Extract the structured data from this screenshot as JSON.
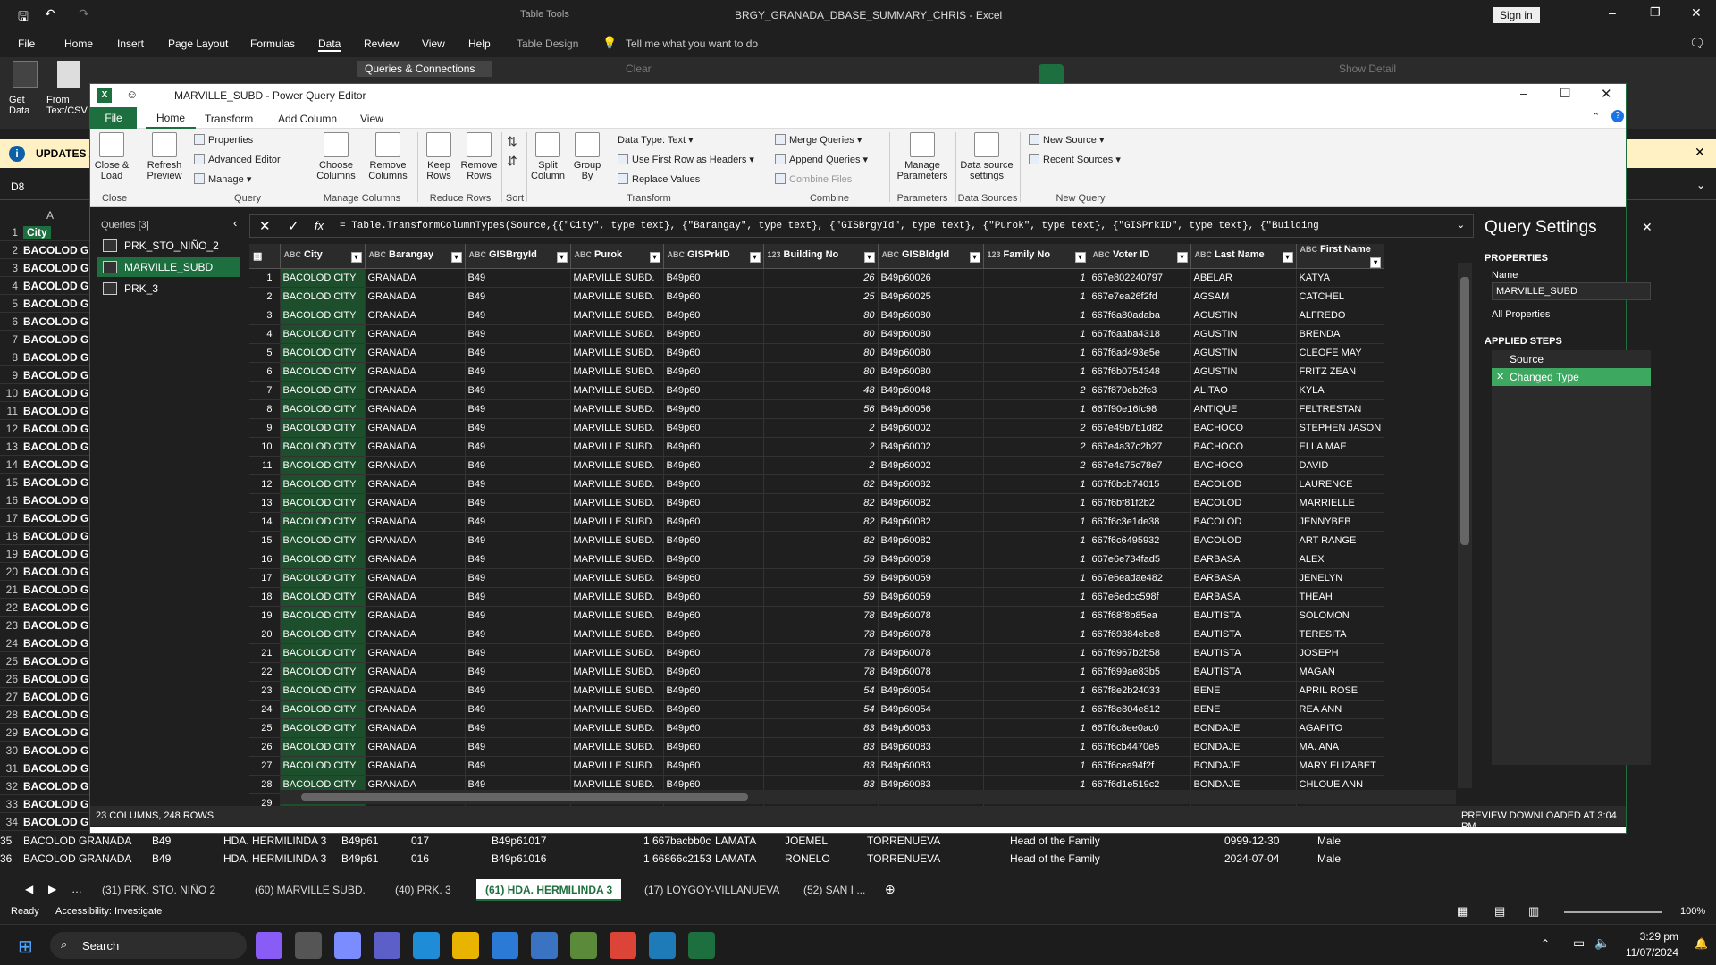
{
  "excel": {
    "title": "BRGY_GRANADA_DBASE_SUMMARY_CHRIS - Excel",
    "table_tools": "Table Tools",
    "sign_in": "Sign in",
    "menu": [
      "File",
      "Home",
      "Insert",
      "Page Layout",
      "Formulas",
      "Data",
      "Review",
      "View",
      "Help",
      "Table Design"
    ],
    "tell_me": "Tell me what you want to do",
    "ribbon": {
      "get_data": "Get Data",
      "from_text": "From Text/CSV",
      "queries_connections": "Queries & Connections",
      "clear": "Clear",
      "show_detail": "Show Detail"
    },
    "info_bar": "UPDATES A",
    "name_box": "D8",
    "col_a": "A",
    "col_b": "B",
    "header_city": "City",
    "left_rows": [
      "1",
      "2",
      "3",
      "4",
      "5",
      "6",
      "7",
      "8",
      "9",
      "10",
      "11",
      "12",
      "13",
      "14",
      "15",
      "16",
      "17",
      "18",
      "19",
      "20",
      "21",
      "22",
      "23",
      "24",
      "25",
      "26",
      "27",
      "28",
      "29",
      "30",
      "31",
      "32",
      "33",
      "34"
    ],
    "left_cell": "BACOLOD G",
    "bottom_rows": [
      {
        "rn": "35",
        "a": "BACOLOD GRANADA",
        "b": "B49",
        "c": "HDA. HERMILINDA 3",
        "d": "B49p61",
        "e": "017",
        "f": "B49p61017",
        "g": "1",
        "h": "667bacbb0c",
        "i": "LAMATA",
        "j": "JOEMEL",
        "k": "TORRENUEVA",
        "l": "Head of the Family",
        "m": "0999-12-30",
        "n": "Male"
      },
      {
        "rn": "36",
        "a": "BACOLOD GRANADA",
        "b": "B49",
        "c": "HDA. HERMILINDA 3",
        "d": "B49p61",
        "e": "016",
        "f": "B49p61016",
        "g": "1",
        "h": "66866c2153",
        "i": "LAMATA",
        "j": "RONELO",
        "k": "TORRENUEVA",
        "l": "Head of the Family",
        "m": "2024-07-04",
        "n": "Male"
      }
    ],
    "sheet_tabs": [
      "(31) PRK. STO. NIÑO 2",
      "(60) MARVILLE SUBD.",
      "(40) PRK. 3",
      "(61) HDA. HERMILINDA 3",
      "(17) LOYGOY-VILLANUEVA",
      "(52) SAN I ..."
    ],
    "active_sheet": 3,
    "status_ready": "Ready",
    "accessibility": "Accessibility: Investigate",
    "zoom": "100%"
  },
  "pq": {
    "title": "MARVILLE_SUBD - Power Query Editor",
    "tabs": [
      "File",
      "Home",
      "Transform",
      "Add Column",
      "View"
    ],
    "ribbon": {
      "close_load": "Close & Load",
      "refresh_preview": "Refresh Preview",
      "properties": "Properties",
      "advanced_editor": "Advanced Editor",
      "manage": "Manage",
      "choose_columns": "Choose Columns",
      "remove_columns": "Remove Columns",
      "keep_rows": "Keep Rows",
      "remove_rows": "Remove Rows",
      "split_column": "Split Column",
      "group_by": "Group By",
      "data_type": "Data Type: Text",
      "first_row_headers": "Use First Row as Headers",
      "replace_values": "Replace Values",
      "merge_queries": "Merge Queries",
      "append_queries": "Append Queries",
      "combine_files": "Combine Files",
      "manage_parameters": "Manage Parameters",
      "data_source_settings": "Data source settings",
      "new_source": "New Source",
      "recent_sources": "Recent Sources",
      "groups": [
        "Close",
        "Query",
        "Manage Columns",
        "Reduce Rows",
        "Sort",
        "Transform",
        "Combine",
        "Parameters",
        "Data Sources",
        "New Query"
      ]
    },
    "queries_header": "Queries [3]",
    "queries": [
      "PRK_STO_NIÑO_2",
      "MARVILLE_SUBD",
      "PRK_3"
    ],
    "selected_query": 1,
    "formula": "= Table.TransformColumnTypes(Source,{{\"City\", type text}, {\"Barangay\", type text}, {\"GISBrgyId\", type text}, {\"Purok\", type text}, {\"GISPrkID\", type text}, {\"Building",
    "columns": [
      {
        "type": "ABC",
        "name": "City"
      },
      {
        "type": "ABC",
        "name": "Barangay"
      },
      {
        "type": "ABC",
        "name": "GISBrgyId"
      },
      {
        "type": "ABC",
        "name": "Purok"
      },
      {
        "type": "ABC",
        "name": "GISPrkID"
      },
      {
        "type": "123",
        "name": "Building No"
      },
      {
        "type": "ABC",
        "name": "GISBldgId"
      },
      {
        "type": "123",
        "name": "Family No"
      },
      {
        "type": "ABC",
        "name": "Voter ID"
      },
      {
        "type": "ABC",
        "name": "Last Name"
      },
      {
        "type": "ABC",
        "name": "First Name"
      }
    ],
    "rows": [
      [
        "1",
        "BACOLOD CITY",
        "GRANADA",
        "B49",
        "MARVILLE SUBD.",
        "B49p60",
        "26",
        "B49p60026",
        "1",
        "667e802240797",
        "ABELAR",
        "KATYA"
      ],
      [
        "2",
        "BACOLOD CITY",
        "GRANADA",
        "B49",
        "MARVILLE SUBD.",
        "B49p60",
        "25",
        "B49p60025",
        "1",
        "667e7ea26f2fd",
        "AGSAM",
        "CATCHEL"
      ],
      [
        "3",
        "BACOLOD CITY",
        "GRANADA",
        "B49",
        "MARVILLE SUBD.",
        "B49p60",
        "80",
        "B49p60080",
        "1",
        "667f6a80adaba",
        "AGUSTIN",
        "ALFREDO"
      ],
      [
        "4",
        "BACOLOD CITY",
        "GRANADA",
        "B49",
        "MARVILLE SUBD.",
        "B49p60",
        "80",
        "B49p60080",
        "1",
        "667f6aaba4318",
        "AGUSTIN",
        "BRENDA"
      ],
      [
        "5",
        "BACOLOD CITY",
        "GRANADA",
        "B49",
        "MARVILLE SUBD.",
        "B49p60",
        "80",
        "B49p60080",
        "1",
        "667f6ad493e5e",
        "AGUSTIN",
        "CLEOFE MAY"
      ],
      [
        "6",
        "BACOLOD CITY",
        "GRANADA",
        "B49",
        "MARVILLE SUBD.",
        "B49p60",
        "80",
        "B49p60080",
        "1",
        "667f6b0754348",
        "AGUSTIN",
        "FRITZ ZEAN"
      ],
      [
        "7",
        "BACOLOD CITY",
        "GRANADA",
        "B49",
        "MARVILLE SUBD.",
        "B49p60",
        "48",
        "B49p60048",
        "2",
        "667f870eb2fc3",
        "ALITAO",
        "KYLA"
      ],
      [
        "8",
        "BACOLOD CITY",
        "GRANADA",
        "B49",
        "MARVILLE SUBD.",
        "B49p60",
        "56",
        "B49p60056",
        "1",
        "667f90e16fc98",
        "ANTIQUE",
        "FELTRESTAN"
      ],
      [
        "9",
        "BACOLOD CITY",
        "GRANADA",
        "B49",
        "MARVILLE SUBD.",
        "B49p60",
        "2",
        "B49p60002",
        "2",
        "667e49b7b1d82",
        "BACHOCO",
        "STEPHEN JASON"
      ],
      [
        "10",
        "BACOLOD CITY",
        "GRANADA",
        "B49",
        "MARVILLE SUBD.",
        "B49p60",
        "2",
        "B49p60002",
        "2",
        "667e4a37c2b27",
        "BACHOCO",
        "ELLA MAE"
      ],
      [
        "11",
        "BACOLOD CITY",
        "GRANADA",
        "B49",
        "MARVILLE SUBD.",
        "B49p60",
        "2",
        "B49p60002",
        "2",
        "667e4a75c78e7",
        "BACHOCO",
        "DAVID"
      ],
      [
        "12",
        "BACOLOD CITY",
        "GRANADA",
        "B49",
        "MARVILLE SUBD.",
        "B49p60",
        "82",
        "B49p60082",
        "1",
        "667f6bcb74015",
        "BACOLOD",
        "LAURENCE"
      ],
      [
        "13",
        "BACOLOD CITY",
        "GRANADA",
        "B49",
        "MARVILLE SUBD.",
        "B49p60",
        "82",
        "B49p60082",
        "1",
        "667f6bf81f2b2",
        "BACOLOD",
        "MARRIELLE"
      ],
      [
        "14",
        "BACOLOD CITY",
        "GRANADA",
        "B49",
        "MARVILLE SUBD.",
        "B49p60",
        "82",
        "B49p60082",
        "1",
        "667f6c3e1de38",
        "BACOLOD",
        "JENNYBEB"
      ],
      [
        "15",
        "BACOLOD CITY",
        "GRANADA",
        "B49",
        "MARVILLE SUBD.",
        "B49p60",
        "82",
        "B49p60082",
        "1",
        "667f6c6495932",
        "BACOLOD",
        "ART RANGE"
      ],
      [
        "16",
        "BACOLOD CITY",
        "GRANADA",
        "B49",
        "MARVILLE SUBD.",
        "B49p60",
        "59",
        "B49p60059",
        "1",
        "667e6e734fad5",
        "BARBASA",
        "ALEX"
      ],
      [
        "17",
        "BACOLOD CITY",
        "GRANADA",
        "B49",
        "MARVILLE SUBD.",
        "B49p60",
        "59",
        "B49p60059",
        "1",
        "667e6eadae482",
        "BARBASA",
        "JENELYN"
      ],
      [
        "18",
        "BACOLOD CITY",
        "GRANADA",
        "B49",
        "MARVILLE SUBD.",
        "B49p60",
        "59",
        "B49p60059",
        "1",
        "667e6edcc598f",
        "BARBASA",
        "THEAH"
      ],
      [
        "19",
        "BACOLOD CITY",
        "GRANADA",
        "B49",
        "MARVILLE SUBD.",
        "B49p60",
        "78",
        "B49p60078",
        "1",
        "667f68f8b85ea",
        "BAUTISTA",
        "SOLOMON"
      ],
      [
        "20",
        "BACOLOD CITY",
        "GRANADA",
        "B49",
        "MARVILLE SUBD.",
        "B49p60",
        "78",
        "B49p60078",
        "1",
        "667f69384ebe8",
        "BAUTISTA",
        "TERESITA"
      ],
      [
        "21",
        "BACOLOD CITY",
        "GRANADA",
        "B49",
        "MARVILLE SUBD.",
        "B49p60",
        "78",
        "B49p60078",
        "1",
        "667f6967b2b58",
        "BAUTISTA",
        "JOSEPH"
      ],
      [
        "22",
        "BACOLOD CITY",
        "GRANADA",
        "B49",
        "MARVILLE SUBD.",
        "B49p60",
        "78",
        "B49p60078",
        "1",
        "667f699ae83b5",
        "BAUTISTA",
        "MAGAN"
      ],
      [
        "23",
        "BACOLOD CITY",
        "GRANADA",
        "B49",
        "MARVILLE SUBD.",
        "B49p60",
        "54",
        "B49p60054",
        "1",
        "667f8e2b24033",
        "BENE",
        "APRIL ROSE"
      ],
      [
        "24",
        "BACOLOD CITY",
        "GRANADA",
        "B49",
        "MARVILLE SUBD.",
        "B49p60",
        "54",
        "B49p60054",
        "1",
        "667f8e804e812",
        "BENE",
        "REA ANN"
      ],
      [
        "25",
        "BACOLOD CITY",
        "GRANADA",
        "B49",
        "MARVILLE SUBD.",
        "B49p60",
        "83",
        "B49p60083",
        "1",
        "667f6c8ee0ac0",
        "BONDAJE",
        "AGAPITO"
      ],
      [
        "26",
        "BACOLOD CITY",
        "GRANADA",
        "B49",
        "MARVILLE SUBD.",
        "B49p60",
        "83",
        "B49p60083",
        "1",
        "667f6cb4470e5",
        "BONDAJE",
        "MA. ANA"
      ],
      [
        "27",
        "BACOLOD CITY",
        "GRANADA",
        "B49",
        "MARVILLE SUBD.",
        "B49p60",
        "83",
        "B49p60083",
        "1",
        "667f6cea94f2f",
        "BONDAJE",
        "MARY ELIZABET"
      ],
      [
        "28",
        "BACOLOD CITY",
        "GRANADA",
        "B49",
        "MARVILLE SUBD.",
        "B49p60",
        "83",
        "B49p60083",
        "1",
        "667f6d1e519c2",
        "BONDAJE",
        "CHLOUE ANN"
      ],
      [
        "29",
        "",
        "",
        "",
        "",
        "",
        "",
        "",
        "",
        "",
        "",
        ""
      ]
    ],
    "settings": {
      "title": "Query Settings",
      "properties": "PROPERTIES",
      "name_label": "Name",
      "name_value": "MARVILLE_SUBD",
      "all_properties": "All Properties",
      "applied_steps": "APPLIED STEPS",
      "steps": [
        "Source",
        "Changed Type"
      ]
    },
    "status_left": "23 COLUMNS, 248 ROWS",
    "status_right": "PREVIEW DOWNLOADED AT 3:04 PM"
  },
  "taskbar": {
    "search": "Search",
    "time": "3:29 pm",
    "date": "11/07/2024"
  },
  "colors": {
    "excel_green": "#1e6f3f",
    "pq_selected": "#1e6f3f",
    "info_bar": "#fff1c4"
  }
}
